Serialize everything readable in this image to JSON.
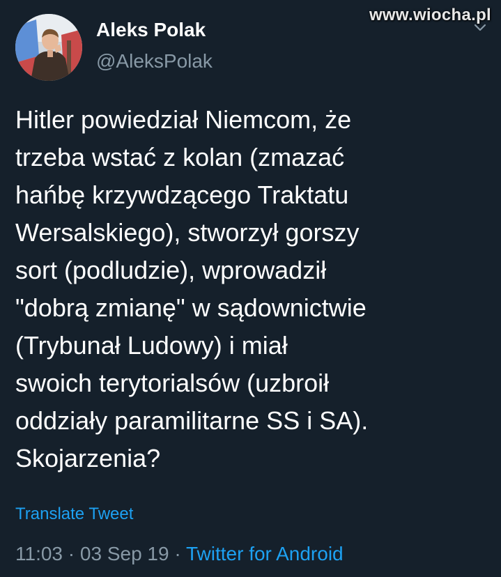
{
  "watermark": "www.wiocha.pl",
  "author": {
    "display_name": "Aleks Polak",
    "handle": "@AleksPolak"
  },
  "tweet": {
    "lines": [
      "Hitler powiedział Niemcom, że",
      "trzeba wstać z kolan (zmazać",
      "hańbę krzywdzącego Traktatu",
      "Wersalskiego), stworzył gorszy",
      "sort (podludzie), wprowadził",
      "\"dobrą zmianę\" w sądownictwie",
      "(Trybunał Ludowy) i miał",
      "swoich terytorialsów (uzbroił",
      "oddziały paramilitarne SS i SA).",
      "Skojarzenia?"
    ],
    "translate_label": "Translate Tweet"
  },
  "meta": {
    "time": "11:03",
    "separator": " · ",
    "date": "03 Sep 19",
    "source": "Twitter for Android"
  },
  "colors": {
    "background": "#15202b",
    "text": "#ffffff",
    "secondary": "#8899a6",
    "accent": "#1da1f2"
  },
  "icons": {
    "menu": "chevron-down-icon"
  }
}
